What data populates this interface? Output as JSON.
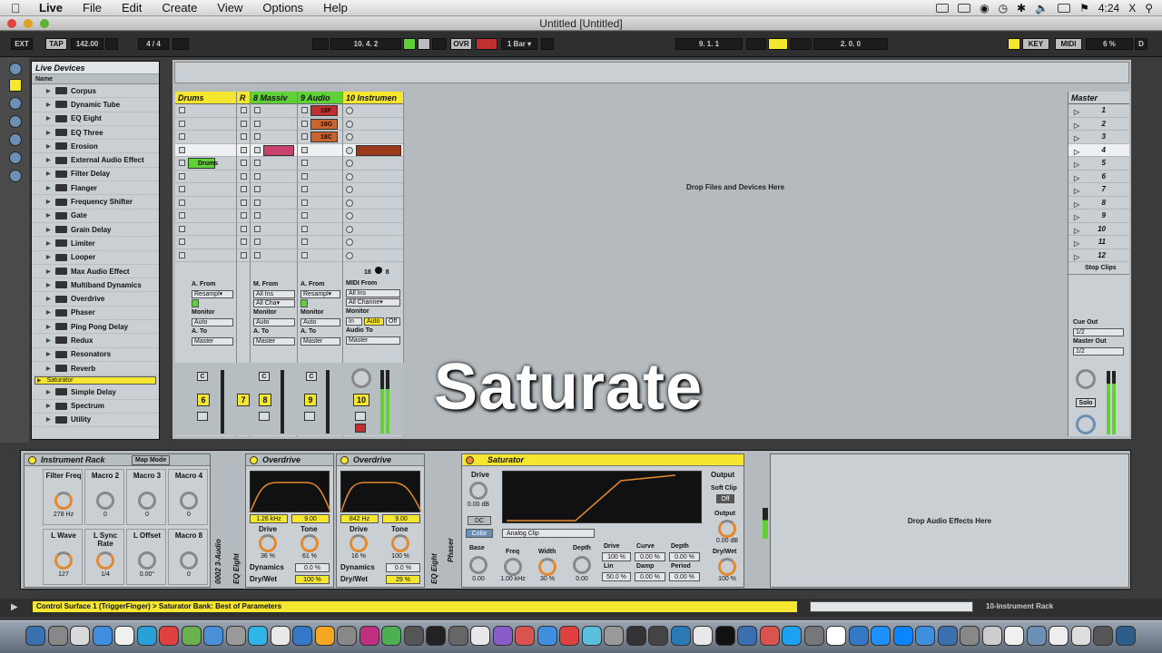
{
  "menubar": {
    "items": [
      "Live",
      "File",
      "Edit",
      "Create",
      "View",
      "Options",
      "Help"
    ],
    "time": "4:24",
    "user_initial": "X"
  },
  "window": {
    "title": "Untitled  [Untitled]"
  },
  "control_bar": {
    "ext": "EXT",
    "tap": "TAP",
    "tempo": "142.00",
    "signature": "4 / 4",
    "position": "10.  4.  2",
    "ovr": "OVR",
    "quantize": "1 Bar ▾",
    "loop_start": "9.  1.  1",
    "loop_length": "2.  0.  0",
    "key": "KEY",
    "midi": "MIDI",
    "cpu": "6 %",
    "d": "D"
  },
  "browser": {
    "title": "Live Devices",
    "column": "Name",
    "items": [
      "Corpus",
      "Dynamic Tube",
      "EQ Eight",
      "EQ Three",
      "Erosion",
      "External Audio Effect",
      "Filter Delay",
      "Flanger",
      "Frequency Shifter",
      "Gate",
      "Grain Delay",
      "Limiter",
      "Looper",
      "Max Audio Effect",
      "Multiband Dynamics",
      "Overdrive",
      "Phaser",
      "Ping Pong Delay",
      "Redux",
      "Resonators",
      "Reverb",
      "Saturator",
      "Simple Delay",
      "Spectrum",
      "Utility"
    ],
    "selected": "Saturator"
  },
  "tracks": [
    {
      "name": "Drums",
      "color": "#f5e62f",
      "clip": "Drums",
      "from": "A. From",
      "input": "Resampl▾",
      "monitor": "Auto",
      "to_label": "A. To",
      "out": "Master",
      "num": "6"
    },
    {
      "name": "R",
      "color": "#f5e62f",
      "num": "7"
    },
    {
      "name": "8 Massiv",
      "color": "#5fd036",
      "from": "M. From",
      "input": "All Ins",
      "channel": "All Cha▾",
      "monitor": "Auto",
      "to_label": "A. To",
      "out": "Master",
      "num": "8"
    },
    {
      "name": "9 Audio",
      "color": "#5fd036",
      "from": "A. From",
      "input": "Resampl▾",
      "monitor": "Auto",
      "to_label": "A. To",
      "out": "Master",
      "num": "9",
      "clips": [
        "18F",
        "18G",
        "18C 2"
      ]
    },
    {
      "name": "10 Instrumen",
      "color": "#f5e62f",
      "from": "MIDI From",
      "input": "All Ins",
      "channel": "All Channe▾",
      "monitor_label": "Monitor",
      "mon_in": "In",
      "mon_auto": "Auto",
      "mon_off": "Off",
      "to_label": "Audio To",
      "out": "Master",
      "num": "10",
      "io": "18",
      "io2": "8"
    }
  ],
  "session": {
    "drop_text": "Drop Files and Devices Here",
    "monitor_label": "Monitor",
    "cue_label": "C"
  },
  "master": {
    "name": "Master",
    "scenes": [
      "1",
      "2",
      "3",
      "4",
      "5",
      "6",
      "7",
      "8",
      "9",
      "10",
      "11",
      "12"
    ],
    "stop_clips": "Stop Clips",
    "cue_out": "Cue Out",
    "cue_val": "1/2",
    "master_out": "Master Out",
    "master_val": "1/2",
    "solo": "Solo"
  },
  "overlay": "Saturate",
  "rack": {
    "title": "Instrument Rack",
    "map_mode": "Map Mode",
    "macros": [
      {
        "label": "Filter Freq",
        "value": "278 Hz"
      },
      {
        "label": "Macro 2",
        "value": "0"
      },
      {
        "label": "Macro 3",
        "value": "0"
      },
      {
        "label": "Macro 4",
        "value": "0"
      },
      {
        "label": "L Wave",
        "value": "127"
      },
      {
        "label": "L Sync Rate",
        "value": "1/4"
      },
      {
        "label": "L Offset",
        "value": "0.00°"
      },
      {
        "label": "Macro 8",
        "value": "0"
      }
    ],
    "side_label": "0002 3-Audio"
  },
  "eq_label": "EQ Eight",
  "overdrive1": {
    "title": "Overdrive",
    "freq": "1.26 kHz",
    "bw": "9.00",
    "drive_label": "Drive",
    "drive": "36 %",
    "tone_label": "Tone",
    "tone": "61 %",
    "dyn_label": "Dynamics",
    "dyn": "0.0 %",
    "dw_label": "Dry/Wet",
    "dw": "100 %"
  },
  "overdrive2": {
    "title": "Overdrive",
    "freq": "842 Hz",
    "bw": "9.00",
    "drive_label": "Drive",
    "drive": "16 %",
    "tone_label": "Tone",
    "tone": "100 %",
    "dyn_label": "Dynamics",
    "dyn": "0.0 %",
    "dw_label": "Dry/Wet",
    "dw": "29 %"
  },
  "eq_label2": "EQ Eight",
  "phaser_label": "Phaser",
  "saturator": {
    "title": "Saturator",
    "drive_label": "Drive",
    "drive": "0.00 dB",
    "dc": "DC",
    "color": "Color",
    "mode": "Analog Clip",
    "output_label": "Output",
    "soft_clip": "Soft Clip",
    "soft_val": "Off",
    "out_label": "Output",
    "out_val": "0.00 dB",
    "dw_label": "Dry/Wet",
    "dw_val": "100 %",
    "base_label": "Base",
    "base": "0.00",
    "freq_label": "Freq",
    "freq": "1.00 kHz",
    "width_label": "Width",
    "width": "30 %",
    "depth_label": "Depth",
    "depth": "0.00",
    "p_drive_label": "Drive",
    "p_drive": "100 %",
    "curve_label": "Curve",
    "curve": "0.00 %",
    "p_depth_label": "Depth",
    "p_depth": "0.00 %",
    "lin_label": "Lin",
    "lin": "50.0 %",
    "damp_label": "Damp",
    "damp": "0.00 %",
    "period_label": "Period",
    "period": "0.00 %"
  },
  "drop_effects": "Drop Audio Effects Here",
  "status": {
    "text": "Control Surface 1 (TriggerFinger) > Saturator Bank: Best of Parameters",
    "right": "10-Instrument Rack"
  },
  "colors": {
    "yellow": "#f5e62f",
    "green": "#5fd036",
    "orange": "#e38a2f",
    "panel": "#c9cfd3"
  }
}
